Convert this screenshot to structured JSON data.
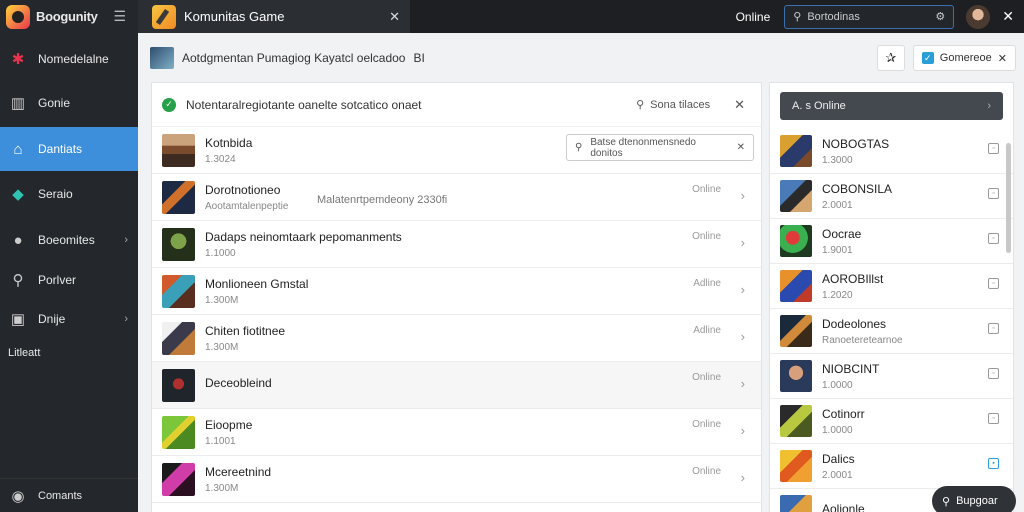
{
  "sidebar": {
    "brand": "Boogunity",
    "items": [
      {
        "label": "Nomedelalne",
        "icon": "puzzle-icon",
        "active": false
      },
      {
        "label": "Gonie",
        "icon": "chart-icon",
        "active": false
      },
      {
        "label": "Dantiats",
        "icon": "store-icon",
        "active": true
      },
      {
        "label": "Seraio",
        "icon": "diamond-icon",
        "active": false
      },
      {
        "label": "Boeomites",
        "icon": "circle-icon",
        "active": false
      },
      {
        "label": "Porlver",
        "icon": "search-icon",
        "active": false
      },
      {
        "label": "Dnije",
        "icon": "image-icon",
        "active": false
      },
      {
        "label": "Litleatt",
        "icon": "grid-icon",
        "active": false
      }
    ],
    "footer": "Comants"
  },
  "topbar": {
    "tab_title": "Komunitas Game",
    "status": "Online",
    "search_text": "Bortodinas"
  },
  "header": {
    "text": "Aotdgmentan Pumagiog Kayatcl oelcadoo",
    "suffix": "BI",
    "btn_label": "Gomereoe"
  },
  "alert": {
    "text": "Notentaralregiotante oanelte sotcatico onaet",
    "search_label": "Sona tilaces"
  },
  "main_search_placeholder": "Batse dtenonmensnedo donitos",
  "rows": [
    {
      "title": "Kotnbida",
      "sub": "1.3024",
      "status": ""
    },
    {
      "title": "Dorotnotioneo",
      "sub": "Aootamtalenpeptie",
      "mid": "Malatenrtpemdeony 2330fi",
      "status": "Online"
    },
    {
      "title": "Dadaps neinomtaark pepomanments",
      "sub": "1.1000",
      "status": "Online"
    },
    {
      "title": "Monlioneen Gmstal",
      "sub": "1.300M",
      "status": "Adline"
    },
    {
      "title": "Chiten fiotitnee",
      "sub": "1.300M",
      "status": "Adline"
    },
    {
      "title": "Deceobleind",
      "sub": "",
      "status": "Online"
    },
    {
      "title": "Eioopme",
      "sub": "1.1001",
      "status": "Online"
    },
    {
      "title": "Mcereetnind",
      "sub": "1.300M",
      "status": "Online"
    }
  ],
  "right_panel": {
    "header": "A. s Online",
    "items": [
      {
        "title": "NOBOGTAS",
        "sub": "1.3000",
        "on": false
      },
      {
        "title": "COBONSILA",
        "sub": "2.0001",
        "on": false
      },
      {
        "title": "Oocrae",
        "sub": "1.9001",
        "on": false
      },
      {
        "title": "AOROBIllst",
        "sub": "1.2020",
        "on": false
      },
      {
        "title": "Dodeolones",
        "sub": "Ranoeteretearnoe",
        "on": false
      },
      {
        "title": "NIOBCINT",
        "sub": "1.0000",
        "on": false
      },
      {
        "title": "Cotinorr",
        "sub": "1.0000",
        "on": false
      },
      {
        "title": "Dalics",
        "sub": "2.0001",
        "on": true
      },
      {
        "title": "Aolionle",
        "sub": "",
        "on": false
      }
    ]
  },
  "fab_label": "Bupgoar"
}
